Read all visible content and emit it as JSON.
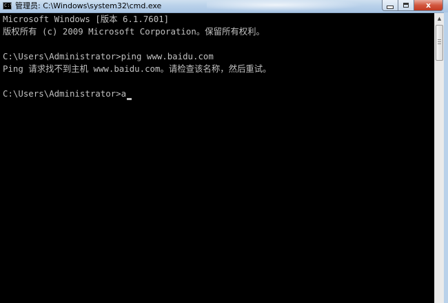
{
  "window": {
    "title": "管理员: C:\\Windows\\system32\\cmd.exe",
    "icon_text": "C:\\",
    "minimize_icon": "minimize-icon",
    "maximize_icon": "maximize-icon",
    "close_label": "x"
  },
  "console": {
    "lines": [
      "Microsoft Windows [版本 6.1.7601]",
      "版权所有 (c) 2009 Microsoft Corporation。保留所有权利。",
      "",
      "C:\\Users\\Administrator>ping www.baidu.com",
      "Ping 请求找不到主机 www.baidu.com。请检查该名称，然后重试。",
      ""
    ],
    "prompt": "C:\\Users\\Administrator>",
    "input": "a",
    "text_color": "#c0c0c0",
    "background": "#000000"
  },
  "scrollbar": {
    "up_arrow": "▲"
  }
}
